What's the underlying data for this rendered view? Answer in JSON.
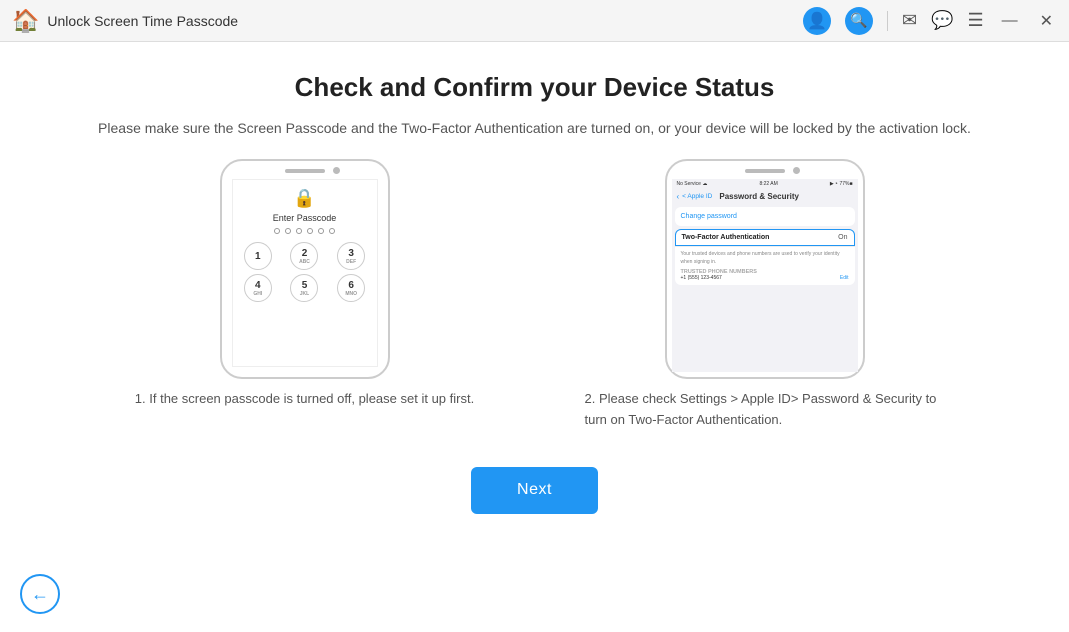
{
  "titlebar": {
    "title": "Unlock Screen Time Passcode",
    "icon": "🏠"
  },
  "page": {
    "heading": "Check and Confirm your Device Status",
    "subtitle": "Please make sure the Screen Passcode and the Two-Factor Authentication are turned on, or your device will be locked by the activation lock.",
    "caption1": "1. If the screen passcode is turned off, please set it up first.",
    "caption2": "2. Please check Settings > Apple ID> Password & Security to turn on Two-Factor Authentication.",
    "next_button": "Next"
  },
  "phone1": {
    "enter_passcode": "Enter Passcode",
    "keys": [
      {
        "num": "1",
        "sub": ""
      },
      {
        "num": "2",
        "sub": "ABC"
      },
      {
        "num": "3",
        "sub": "DEF"
      },
      {
        "num": "4",
        "sub": "GHI"
      },
      {
        "num": "5",
        "sub": "JKL"
      },
      {
        "num": "6",
        "sub": "MNO"
      }
    ]
  },
  "phone2": {
    "status_left": "No Service ☁",
    "status_time": "8:22 AM",
    "status_right": "▶ ‣ 77%■",
    "back_label": "< Apple ID",
    "header_title": "Password & Security",
    "change_password": "Change password",
    "two_factor_label": "Two-Factor Authentication",
    "two_factor_value": "On",
    "info_text": "Your trusted devices and phone numbers are used to verify your identity when signing in.",
    "trusted_header": "TRUSTED PHONE NUMBERS",
    "edit_label": "Edit"
  },
  "icons": {
    "avatar": "👤",
    "search": "🔍",
    "mail": "✉",
    "chat": "💬",
    "menu": "☰",
    "minimize": "—",
    "close": "✕",
    "lock": "🔒",
    "back_arrow": "←"
  }
}
